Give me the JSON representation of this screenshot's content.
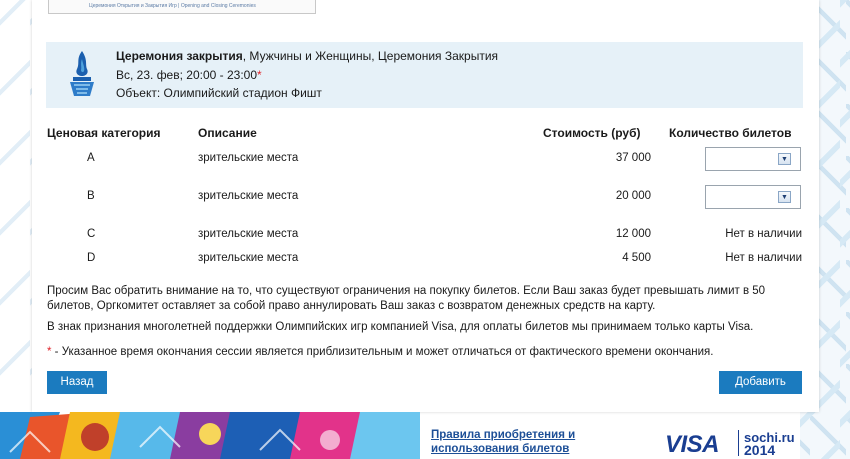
{
  "event": {
    "title_bold": "Церемония закрытия",
    "title_rest": ", Мужчины и Женщины, Церемония Закрытия",
    "date": "Вс, 23. фев; 20:00 - 23:00",
    "asterisk": "*",
    "venue": "Объект: Олимпийский стадион Фишт"
  },
  "top_banner": {
    "caption": "Церемония Открытия и Закрытия Игр  |  Opening and Closing Ceremonies"
  },
  "table": {
    "headers": {
      "category": "Ценовая категория",
      "description": "Описание",
      "price": "Стоимость (руб)",
      "quantity": "Количество билетов"
    },
    "rows": [
      {
        "category": "A",
        "description": "зрительские места",
        "price": "37 000",
        "quantity": "",
        "available": true
      },
      {
        "category": "B",
        "description": "зрительские места",
        "price": "20 000",
        "quantity": "",
        "available": true
      },
      {
        "category": "C",
        "description": "зрительские места",
        "price": "12 000",
        "quantity": "Нет в наличии",
        "available": false
      },
      {
        "category": "D",
        "description": "зрительские места",
        "price": "4 500",
        "quantity": "Нет в наличии",
        "available": false
      }
    ]
  },
  "notices": {
    "limit": "Просим Вас обратить внимание на то, что существуют ограничения на покупку билетов. Если Ваш заказ будет превышать лимит в 50 билетов, Оргкомитет оставляет за собой право аннулировать Ваш заказ с возвратом денежных средств на карту.",
    "visa": "В знак признания многолетней поддержки Олимпийских игр компанией Visa, для оплаты билетов мы принимаем только карты Visa.",
    "asterisk": "*",
    "time_note": " - Указанное время окончания сессии является приблизительным и может отличаться от фактического времени окончания."
  },
  "buttons": {
    "back": "Назад",
    "add": "Добавить"
  },
  "footer": {
    "rules_link_line1": "Правила приобретения и",
    "rules_link_line2": "использования билетов",
    "visa_logo": "VISA",
    "sochi_logo_line1": "sochi.ru",
    "sochi_logo_line2": "2014"
  },
  "colors": {
    "accent": "#1b7bbf",
    "event_bg": "#e6f1f8",
    "required": "#e0252b",
    "link": "#1d4f97"
  },
  "icons": {
    "select_arrow": "chevron-down-icon",
    "event": "olympic-flame-icon"
  }
}
